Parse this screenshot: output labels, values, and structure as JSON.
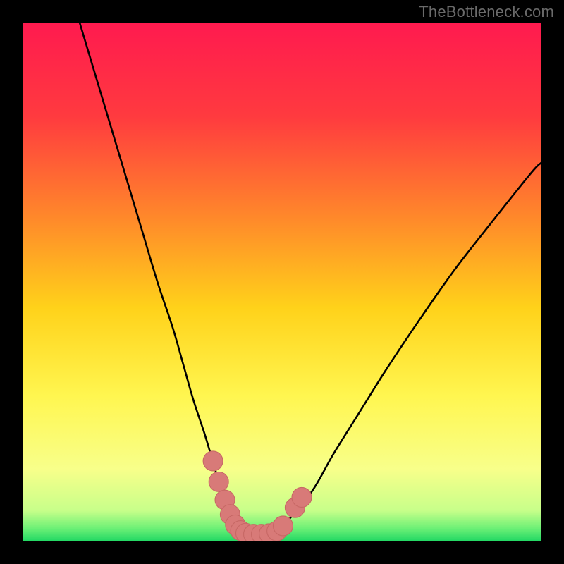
{
  "watermark": "TheBottleneck.com",
  "colors": {
    "frame": "#000000",
    "gradient_stops": [
      {
        "offset": 0.0,
        "color": "#ff1a4f"
      },
      {
        "offset": 0.18,
        "color": "#ff3a3f"
      },
      {
        "offset": 0.38,
        "color": "#ff8a2a"
      },
      {
        "offset": 0.55,
        "color": "#ffd21a"
      },
      {
        "offset": 0.72,
        "color": "#fff650"
      },
      {
        "offset": 0.86,
        "color": "#f8ff8a"
      },
      {
        "offset": 0.94,
        "color": "#c8ff8a"
      },
      {
        "offset": 0.975,
        "color": "#6cf076"
      },
      {
        "offset": 1.0,
        "color": "#1fd763"
      }
    ],
    "curve": "#000000",
    "marker_fill": "#d87a78",
    "marker_stroke": "#c76865"
  },
  "chart_data": {
    "type": "line",
    "title": "",
    "xlabel": "",
    "ylabel": "",
    "xlim": [
      0,
      100
    ],
    "ylim": [
      0,
      100
    ],
    "legend": "none",
    "grid": false,
    "annotations": [
      "TheBottleneck.com"
    ],
    "series": [
      {
        "name": "bottleneck-curve",
        "x": [
          11,
          14,
          17,
          20,
          23,
          26,
          29,
          31,
          33,
          35,
          36.5,
          38,
          39.5,
          41,
          42.5,
          44,
          46,
          49,
          52,
          56,
          60,
          65,
          70,
          76,
          83,
          90,
          98,
          100
        ],
        "y": [
          100,
          90,
          80,
          70,
          60,
          50,
          41,
          34,
          27,
          21,
          16,
          11,
          7,
          4,
          2,
          1.5,
          1.5,
          2,
          5,
          10,
          17,
          25,
          33,
          42,
          52,
          61,
          71,
          73
        ]
      }
    ],
    "markers": [
      {
        "x": 36.7,
        "y": 15.5,
        "r": 1.9
      },
      {
        "x": 37.8,
        "y": 11.5,
        "r": 1.9
      },
      {
        "x": 39.0,
        "y": 8.0,
        "r": 1.9
      },
      {
        "x": 40.0,
        "y": 5.2,
        "r": 1.9
      },
      {
        "x": 41.0,
        "y": 3.2,
        "r": 1.9
      },
      {
        "x": 42.0,
        "y": 2.1,
        "r": 1.9
      },
      {
        "x": 43.0,
        "y": 1.6,
        "r": 1.9
      },
      {
        "x": 44.5,
        "y": 1.4,
        "r": 1.9
      },
      {
        "x": 46.0,
        "y": 1.4,
        "r": 1.9
      },
      {
        "x": 47.5,
        "y": 1.5,
        "r": 1.9
      },
      {
        "x": 49.0,
        "y": 2.0,
        "r": 1.9
      },
      {
        "x": 50.2,
        "y": 3.0,
        "r": 1.9
      },
      {
        "x": 52.5,
        "y": 6.5,
        "r": 1.9
      },
      {
        "x": 53.8,
        "y": 8.5,
        "r": 1.9
      }
    ]
  }
}
